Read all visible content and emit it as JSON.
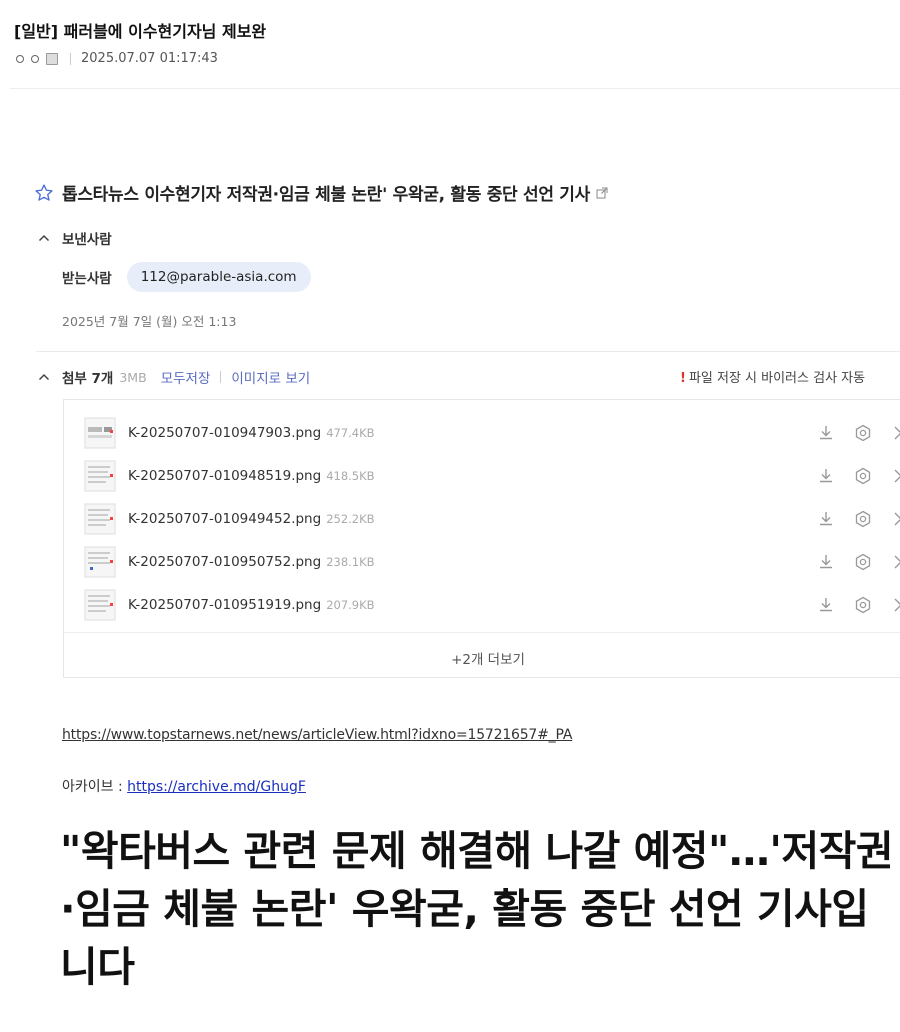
{
  "post": {
    "title": "[일반] 패러블에 이수현기자님 제보완",
    "datetime": "2025.07.07 01:17:43"
  },
  "mail": {
    "subject": "톱스타뉴스 이수현기자 저작권·임금 체불 논란' 우왁굳, 활동 중단 선언 기사",
    "sender_label": "보낸사람",
    "recipient_label": "받는사람",
    "recipient_email": "112@parable-asia.com",
    "date": "2025년 7월 7일 (월) 오전 1:13"
  },
  "attachments": {
    "count_label": "첨부 7개",
    "total_size": "3MB",
    "save_all": "모두저장",
    "view_as_image": "이미지로 보기",
    "virus_notice": "파일 저장 시 바이러스 검사 자동",
    "files": [
      {
        "name": "K-20250707-010947903.png",
        "size": "477.4KB"
      },
      {
        "name": "K-20250707-010948519.png",
        "size": "418.5KB"
      },
      {
        "name": "K-20250707-010949452.png",
        "size": "252.2KB"
      },
      {
        "name": "K-20250707-010950752.png",
        "size": "238.1KB"
      },
      {
        "name": "K-20250707-010951919.png",
        "size": "207.9KB"
      }
    ],
    "more_label": "+2개 더보기"
  },
  "body": {
    "url": "https://www.topstarnews.net/news/articleView.html?idxno=15721657#_PA",
    "archive_label": "아카이브 : ",
    "archive_url": "https://archive.md/GhugF",
    "headline": "\"왁타버스 관련 문제 해결해 나갈 예정\"…'저작권·임금 체불 논란' 우왁굳, 활동 중단 선언 기사입니다"
  },
  "colors": {
    "accent_link": "#5a6cc1",
    "chip_bg": "#e7eef9",
    "warning": "#e0342b",
    "archive_link": "#1a2fbf"
  }
}
